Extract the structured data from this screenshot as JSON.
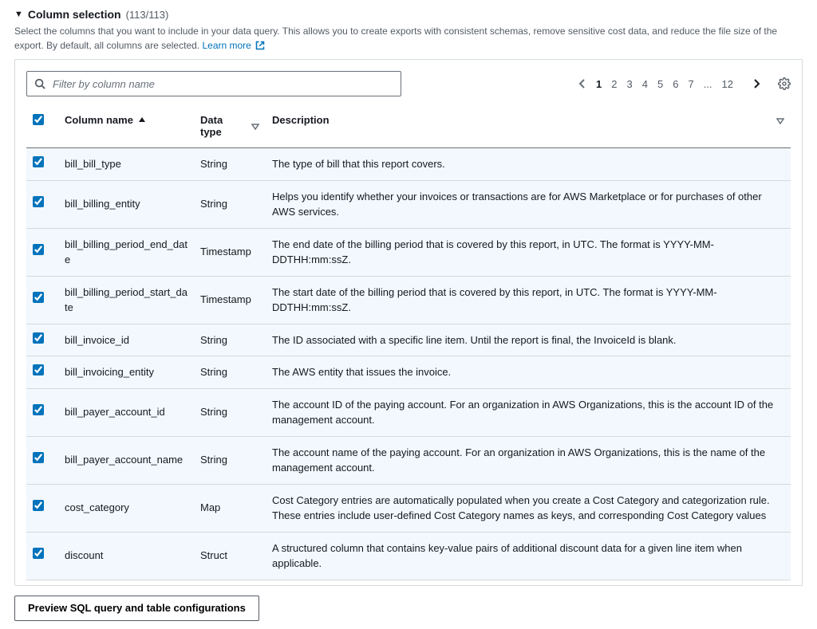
{
  "header": {
    "title": "Column selection",
    "count": "(113/113)",
    "description": "Select the columns that you want to include in your data query. This allows you to create exports with consistent schemas, remove sensitive cost data, and reduce the file size of the export. By default, all columns are selected.",
    "learn_more": "Learn more"
  },
  "toolbar": {
    "search_placeholder": "Filter by column name"
  },
  "pagination": {
    "pages": [
      "1",
      "2",
      "3",
      "4",
      "5",
      "6",
      "7",
      "...",
      "12"
    ],
    "current": "1"
  },
  "table": {
    "headers": {
      "name": "Column name",
      "type": "Data type",
      "desc": "Description"
    },
    "rows": [
      {
        "name": "bill_bill_type",
        "type": "String",
        "desc": "The type of bill that this report covers."
      },
      {
        "name": "bill_billing_entity",
        "type": "String",
        "desc": "Helps you identify whether your invoices or transactions are for AWS Marketplace or for purchases of other AWS services."
      },
      {
        "name": "bill_billing_period_end_date",
        "type": "Timestamp",
        "desc": "The end date of the billing period that is covered by this report, in UTC. The format is YYYY-MM-DDTHH:mm:ssZ."
      },
      {
        "name": "bill_billing_period_start_date",
        "type": "Timestamp",
        "desc": "The start date of the billing period that is covered by this report, in UTC. The format is YYYY-MM-DDTHH:mm:ssZ."
      },
      {
        "name": "bill_invoice_id",
        "type": "String",
        "desc": "The ID associated with a specific line item. Until the report is final, the InvoiceId is blank."
      },
      {
        "name": "bill_invoicing_entity",
        "type": "String",
        "desc": "The AWS entity that issues the invoice."
      },
      {
        "name": "bill_payer_account_id",
        "type": "String",
        "desc": "The account ID of the paying account. For an organization in AWS Organizations, this is the account ID of the management account."
      },
      {
        "name": "bill_payer_account_name",
        "type": "String",
        "desc": "The account name of the paying account. For an organization in AWS Organizations, this is the name of the management account."
      },
      {
        "name": "cost_category",
        "type": "Map",
        "desc": "Cost Category entries are automatically populated when you create a Cost Category and categorization rule. These entries include user-defined Cost Category names as keys, and corresponding Cost Category values"
      },
      {
        "name": "discount",
        "type": "Struct",
        "desc": "A structured column that contains key-value pairs of additional discount data for a given line item when applicable."
      }
    ]
  },
  "buttons": {
    "preview": "Preview SQL query and table configurations"
  }
}
